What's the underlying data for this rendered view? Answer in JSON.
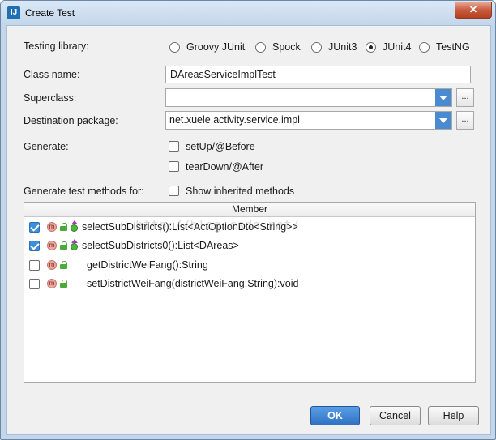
{
  "window": {
    "title": "Create Test",
    "close_symbol": "✕"
  },
  "labels": {
    "testing_library": "Testing library:",
    "class_name": "Class name:",
    "superclass": "Superclass:",
    "destination_package": "Destination package:",
    "generate": "Generate:",
    "generate_methods_for": "Generate test methods for:"
  },
  "testing_library_options": [
    {
      "label": "Groovy JUnit",
      "selected": false
    },
    {
      "label": "Spock",
      "selected": false
    },
    {
      "label": "JUnit3",
      "selected": false
    },
    {
      "label": "JUnit4",
      "selected": true
    },
    {
      "label": "TestNG",
      "selected": false
    }
  ],
  "class_name_value": "DAreasServiceImplTest",
  "superclass_value": "",
  "destination_package_value": "net.xuele.activity.service.impl",
  "browse_label": "...",
  "generate_options": [
    {
      "label": "setUp/@Before",
      "checked": false
    },
    {
      "label": "tearDown/@After",
      "checked": false
    }
  ],
  "show_inherited": {
    "label": "Show inherited methods",
    "checked": false
  },
  "table": {
    "header": "Member",
    "rows": [
      {
        "signature": "selectSubDistricts():List<ActOptionDto<String>>",
        "checked": true,
        "overrides": true
      },
      {
        "signature": "selectSubDistricts0():List<DAreas>",
        "checked": true,
        "overrides": true
      },
      {
        "signature": "getDistrictWeiFang():String",
        "checked": false,
        "overrides": false
      },
      {
        "signature": "setDistrictWeiFang(districtWeiFang:String):void",
        "checked": false,
        "overrides": false
      }
    ]
  },
  "watermark": "http://blog.csdn.net/",
  "buttons": {
    "ok": "OK",
    "cancel": "Cancel",
    "help": "Help"
  },
  "colors": {
    "accent": "#2f72c4",
    "title_bar": "#c3d6ea",
    "content_bg": "#f0f0f0"
  }
}
